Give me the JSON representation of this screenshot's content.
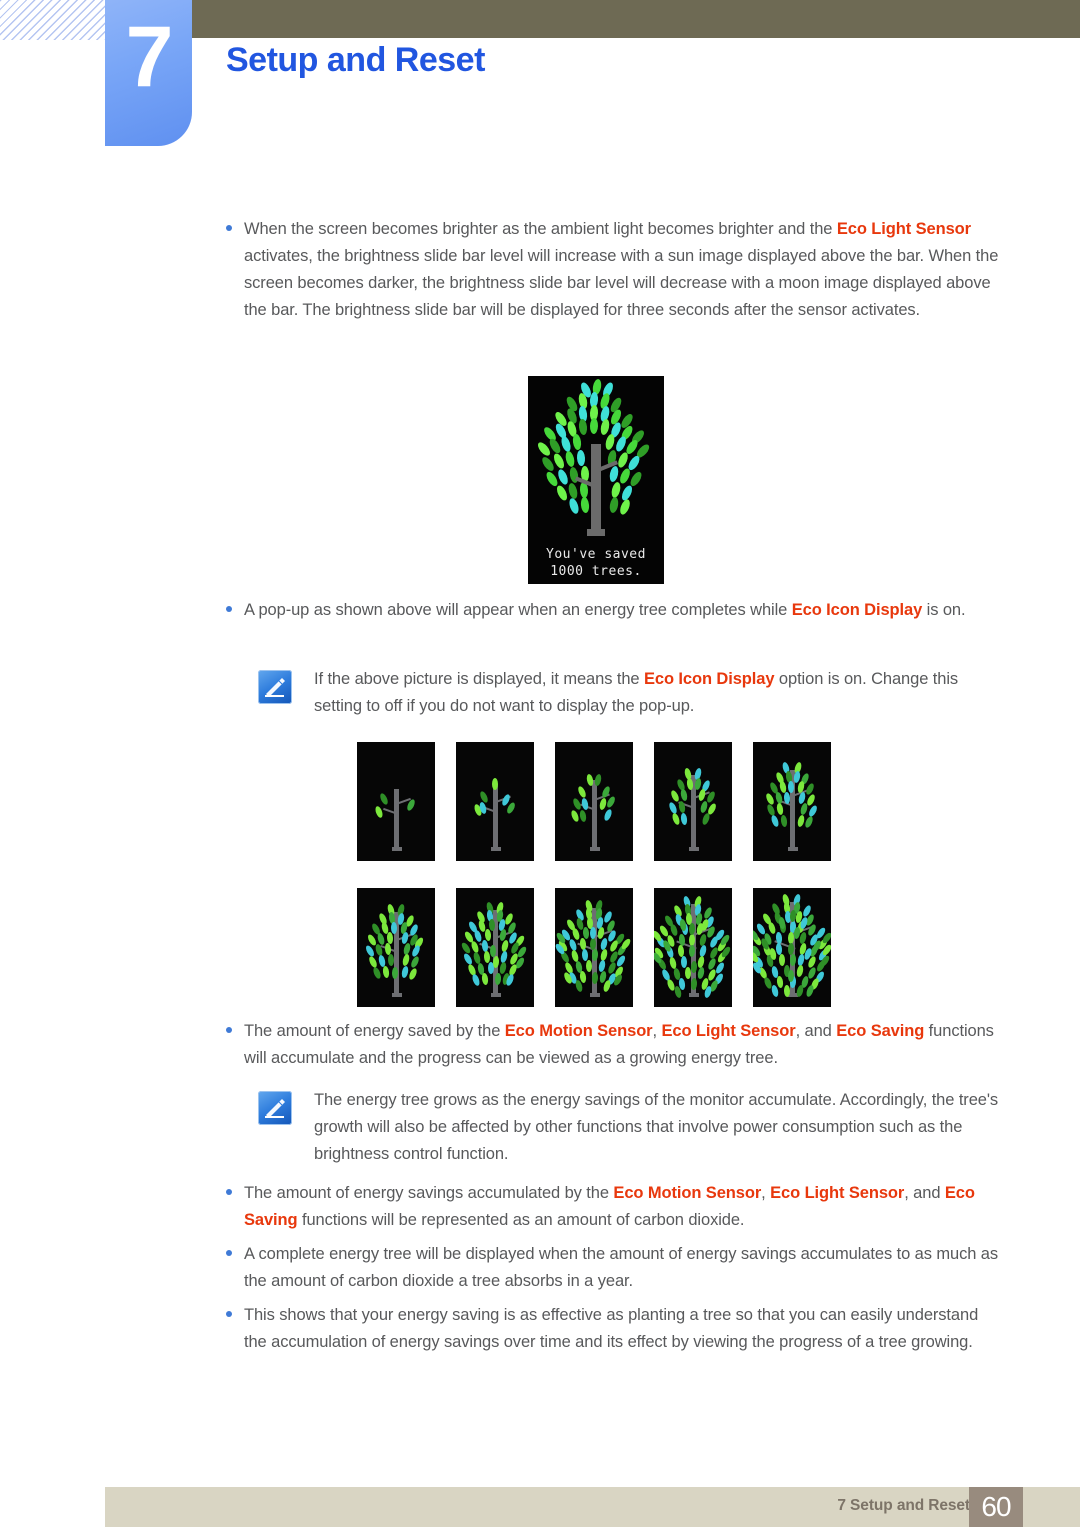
{
  "header": {
    "chapter_number": "7",
    "chapter_title": "Setup and Reset"
  },
  "colors": {
    "accent_blue": "#2156e0",
    "keyword_orange": "#e8380d",
    "badge_blue": "#79a6f7",
    "olive_bar": "#6e6a54",
    "footer_bar": "#d9d5c3",
    "footer_page_box": "#988b7e",
    "body_text": "#58595b"
  },
  "body": {
    "bullet1": {
      "part1": "When the screen becomes brighter as the ambient light becomes brighter and the ",
      "kw1": "Eco Light Sensor",
      "part2": " activates, the brightness slide bar level will increase with a sun image displayed above the bar. When the screen becomes darker, the brightness slide bar level will decrease with a moon image displayed above the bar. The brightness slide bar will be displayed for three seconds after the sensor activates."
    },
    "bullet2": {
      "part1": "A pop-up as shown above will appear when an energy tree completes while ",
      "kw1": "Eco Icon Display",
      "part2": " is on."
    },
    "note1": {
      "part1": "If the above picture is displayed, it means the ",
      "kw1": "Eco Icon Display",
      "part2": " option is on. Change this setting to off if you do not want to display the pop-up."
    },
    "bullet3": {
      "part1": "The amount of energy saved by the ",
      "kw1": "Eco Motion Sensor",
      "sep1": ", ",
      "kw2": "Eco Light Sensor",
      "sep2": ", and ",
      "kw3": "Eco Saving",
      "part2": " functions will accumulate and the progress can be viewed as a growing energy tree."
    },
    "note2": {
      "text": "The energy tree grows as the energy savings of the monitor accumulate. Accordingly, the tree's growth will also be affected by other functions that involve power consumption such as the brightness control function."
    },
    "bullet4": {
      "part1": "The amount of energy savings accumulated by the ",
      "kw1": "Eco Motion Sensor",
      "sep1": ", ",
      "kw2": "Eco Light Sensor",
      "sep2": ", and ",
      "kw3": "Eco Saving",
      "part2": " functions will be represented as an amount of carbon dioxide."
    },
    "bullet5": {
      "text": "A complete energy tree will be displayed when the amount of energy savings accumulates to as much as the amount of carbon dioxide a tree absorbs in a year."
    },
    "bullet6": {
      "text": "This shows that your energy saving is as effective as planting a tree so that you can easily understand the accumulation of energy savings over time and its effect by viewing the progress of a tree growing."
    }
  },
  "popup_image": {
    "caption_line1": "You've saved",
    "caption_line2": "1000 trees."
  },
  "tree_grid": {
    "stages": [
      {
        "stage": 1,
        "leaves": 3
      },
      {
        "stage": 2,
        "leaves": 6
      },
      {
        "stage": 3,
        "leaves": 11
      },
      {
        "stage": 4,
        "leaves": 17
      },
      {
        "stage": 5,
        "leaves": 24
      },
      {
        "stage": 6,
        "leaves": 32
      },
      {
        "stage": 7,
        "leaves": 41
      },
      {
        "stage": 8,
        "leaves": 50
      },
      {
        "stage": 9,
        "leaves": 60
      },
      {
        "stage": 10,
        "leaves": 70
      }
    ]
  },
  "footer": {
    "label": "7 Setup and Reset",
    "page_number": "60"
  }
}
